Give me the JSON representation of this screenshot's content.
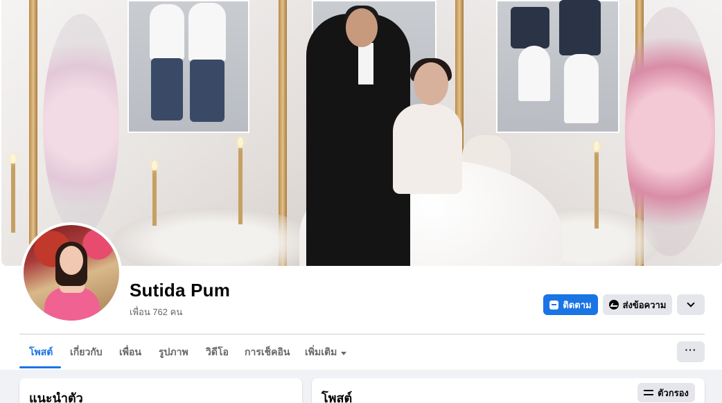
{
  "profile": {
    "name": "Sutida Pum",
    "friends": "เพื่อน 762 คน"
  },
  "actions": {
    "follow": "ติดตาม",
    "message": "ส่งข้อความ"
  },
  "tabs": [
    {
      "label": "โพสต์",
      "active": true
    },
    {
      "label": "เกี่ยวกับ"
    },
    {
      "label": "เพื่อน"
    },
    {
      "label": "รูปภาพ"
    },
    {
      "label": "วิดีโอ"
    },
    {
      "label": "การเช็คอิน"
    },
    {
      "label": "เพิ่มเติม"
    }
  ],
  "tab_more_label": "···",
  "intro": {
    "title": "แนะนำตัว"
  },
  "posts": {
    "title": "โพสต์",
    "filter_label": "ตัวกรอง"
  },
  "icons": {
    "follow": "follow-icon",
    "message": "messenger-icon",
    "dropdown": "chevron-down-icon",
    "filter": "filter-icon"
  },
  "colors": {
    "accent": "#1b74e4",
    "secondary_button": "#e4e6eb",
    "page_bg": "#f0f2f5"
  }
}
